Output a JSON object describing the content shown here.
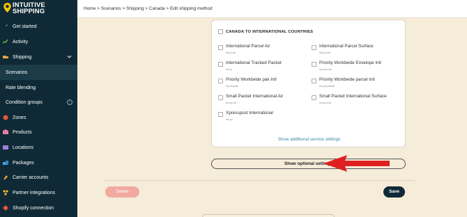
{
  "brand": {
    "line1": "INTUITIVE",
    "line2": "SHIPPING"
  },
  "sidebar": {
    "items": [
      {
        "label": "Get started",
        "icon": "rocket-icon"
      },
      {
        "label": "Activity",
        "icon": "activity-icon"
      },
      {
        "label": "Shipping",
        "icon": "shipping-icon",
        "expanded": true
      },
      {
        "label": "Scenarios",
        "sub": true,
        "active": true
      },
      {
        "label": "Rate blending",
        "sub": true
      },
      {
        "label": "Condition groups",
        "sub": true,
        "icon": "info-icon"
      },
      {
        "label": "Zones",
        "icon": "zones-icon"
      },
      {
        "label": "Products",
        "icon": "products-icon"
      },
      {
        "label": "Locations",
        "icon": "locations-icon"
      },
      {
        "label": "Packages",
        "icon": "packages-icon"
      },
      {
        "label": "Carrier accounts",
        "icon": "carrier-icon"
      },
      {
        "label": "Partner integrations",
        "icon": "partner-icon"
      },
      {
        "label": "Shopify connection",
        "icon": "shopify-icon"
      }
    ]
  },
  "header": {
    "breadcrumb": "Home > Scenarios > Shipping > Canada > Edit shipping method"
  },
  "card": {
    "heading": "CANADA TO INTERNATIONAL COUNTRIES",
    "services": [
      {
        "name": "International Parcel Air",
        "code": "int.ip.air"
      },
      {
        "name": "International Parcel Surface",
        "code": "int.ip.surf"
      },
      {
        "name": "International Tracked Packet",
        "code": "int.tp"
      },
      {
        "name": "Priority Worldwide Envelope Intl",
        "code": "int.pw.env"
      },
      {
        "name": "Priority Worldwide pak Intl",
        "code": "int.pw.pak"
      },
      {
        "name": "Priority Worldwide parcel Intl",
        "code": "int.pw.parcel"
      },
      {
        "name": "Small Packet International Air",
        "code": "int.sp.air"
      },
      {
        "name": "Small Packet International Surface",
        "code": "int.sp.surf"
      },
      {
        "name": "Xpresspost International",
        "code": "int.xp"
      }
    ],
    "additional_link": "Show additional service settings"
  },
  "optional_button": "Show optional settings",
  "actions": {
    "delete": "Delete",
    "save": "Save"
  },
  "colors": {
    "sidebar": "#0f2a36",
    "background": "#f5ecd9",
    "arrow": "#e02020",
    "link": "#3a88a8",
    "delete": "#f2a9a0",
    "logo": "#f5c400"
  }
}
